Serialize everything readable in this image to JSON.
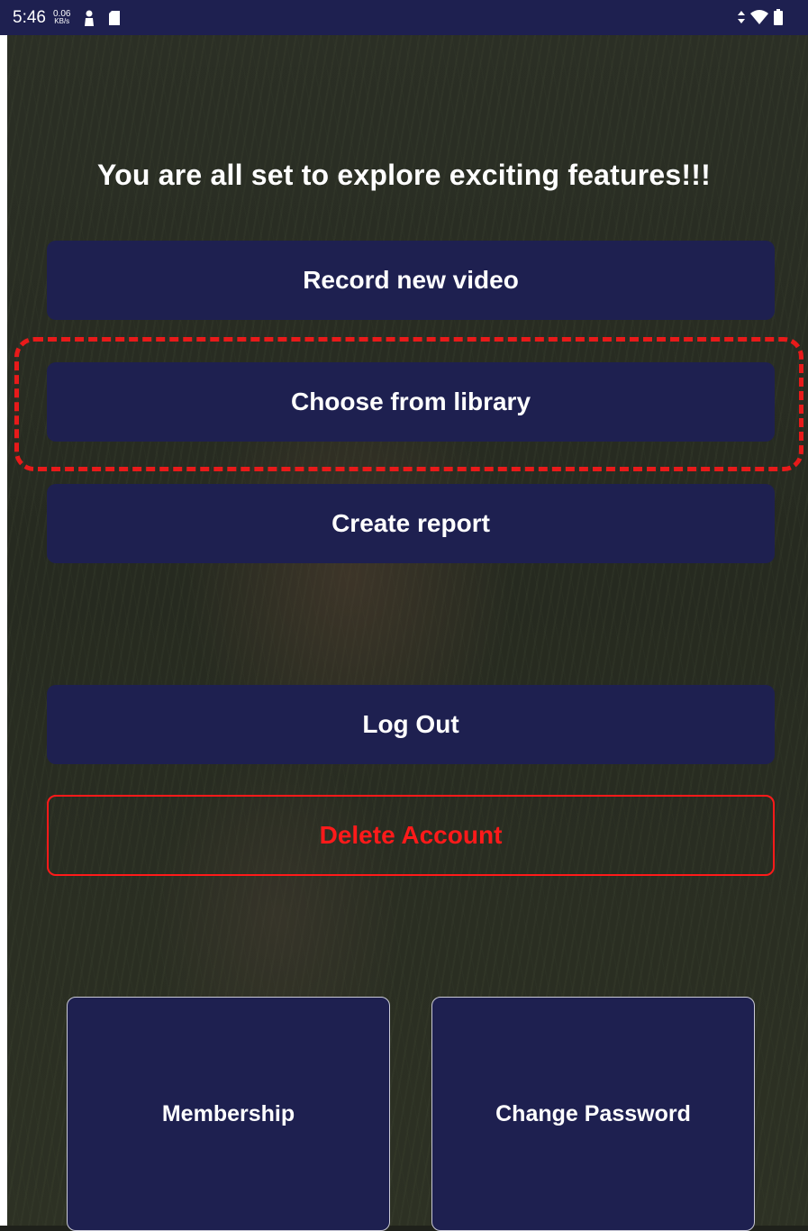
{
  "status_bar": {
    "time": "5:46",
    "net_speed_value": "0.06",
    "net_speed_unit": "KB/s",
    "icons": [
      "person-icon",
      "sd-card-icon",
      "data-arrows-icon",
      "wifi-icon",
      "battery-icon"
    ]
  },
  "headline": "You are all set to explore exciting features!!!",
  "buttons": {
    "record": "Record new video",
    "library": "Choose from library",
    "report": "Create report",
    "logout": "Log Out",
    "delete": "Delete Account"
  },
  "tiles": {
    "membership": "Membership",
    "change_password": "Change Password"
  },
  "colors": {
    "primary": "#1e2050",
    "danger": "#ff1a1a",
    "highlight": "#e81a1a"
  }
}
